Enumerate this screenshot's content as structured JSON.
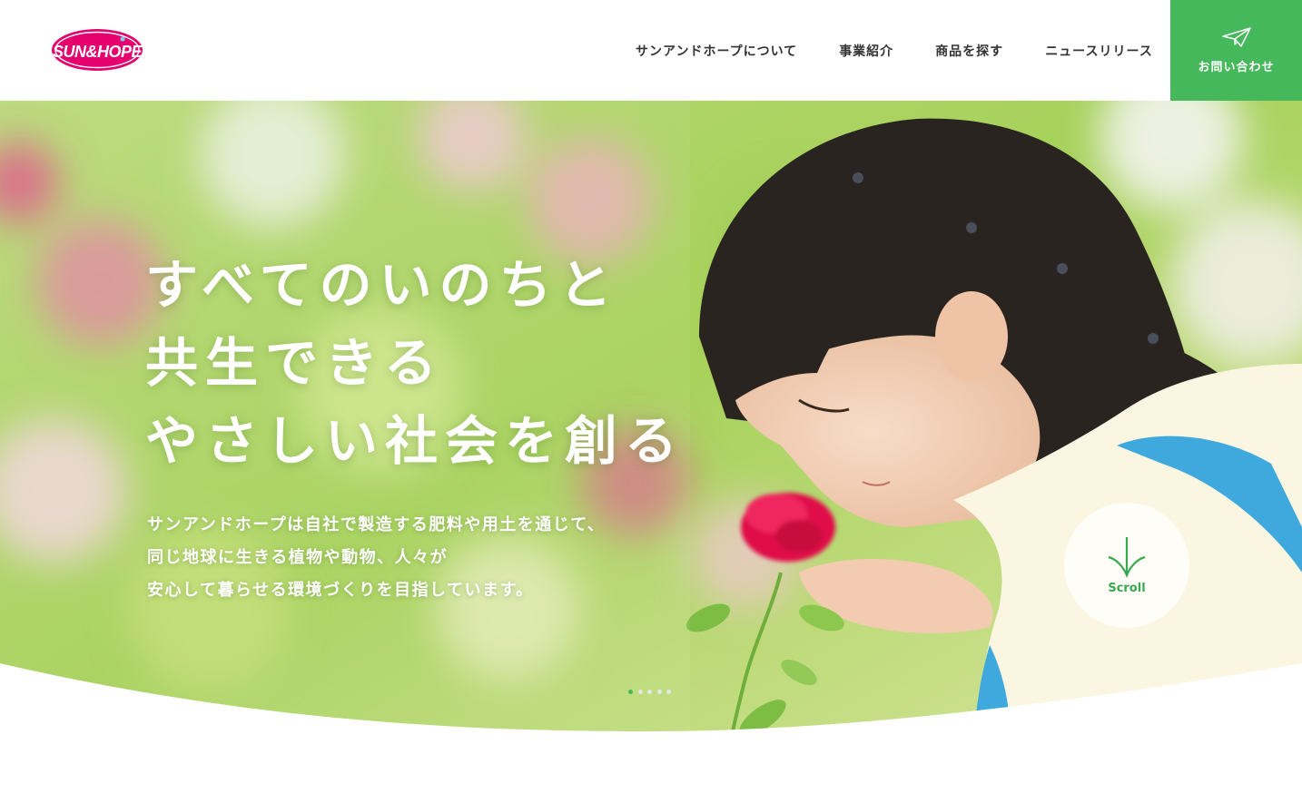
{
  "brand": {
    "logo_text": "SUN&HOPE",
    "logo_color": "#e5006e",
    "accent_color": "#45b85b"
  },
  "nav": {
    "items": [
      {
        "label": "サンアンドホープについて"
      },
      {
        "label": "事業紹介"
      },
      {
        "label": "商品を探す"
      },
      {
        "label": "ニュースリリース"
      }
    ],
    "contact": {
      "label": "お問い合わせ",
      "icon": "paper-plane-icon"
    }
  },
  "hero": {
    "headline": [
      "すべてのいのちと",
      "共生できる",
      "やさしい社会を創る"
    ],
    "lead": [
      "サンアンドホープは自社で製造する肥料や用土を通じて、",
      "同じ地球に生きる植物や動物、人々が",
      "安心して暮らせる環境づくりを目指しています。"
    ],
    "scroll_label": "Scroll",
    "scroll_icon": "down-arrow-sprout-icon",
    "slider": {
      "count": 5,
      "active_index": 0
    },
    "image_description_icon": "girl-smelling-red-flower-photo"
  }
}
